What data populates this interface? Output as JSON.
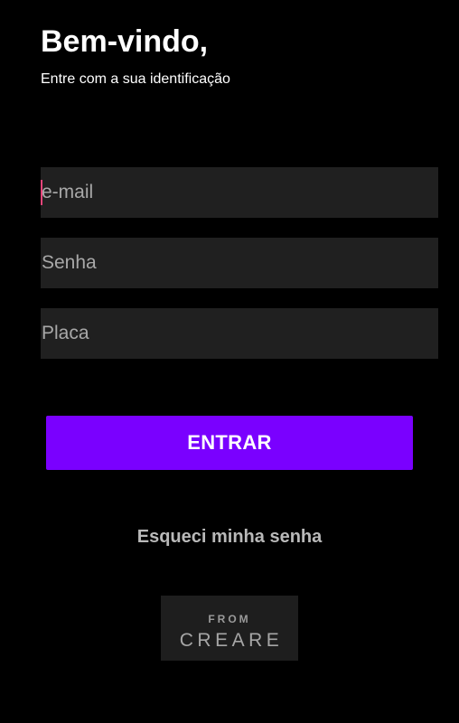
{
  "header": {
    "title": "Bem-vindo,",
    "subtitle": "Entre com a sua identificação"
  },
  "form": {
    "email": {
      "placeholder": "e-mail",
      "value": ""
    },
    "password": {
      "placeholder": "Senha",
      "value": ""
    },
    "plate": {
      "placeholder": "Placa",
      "value": ""
    },
    "submit_label": "ENTRAR"
  },
  "links": {
    "forgot_password": "Esqueci minha senha"
  },
  "brand": {
    "from": "FROM",
    "name": "CREARE"
  },
  "colors": {
    "background": "#000000",
    "field_background": "#202020",
    "primary_button": "#7a00ff",
    "caret": "#e8457a"
  }
}
